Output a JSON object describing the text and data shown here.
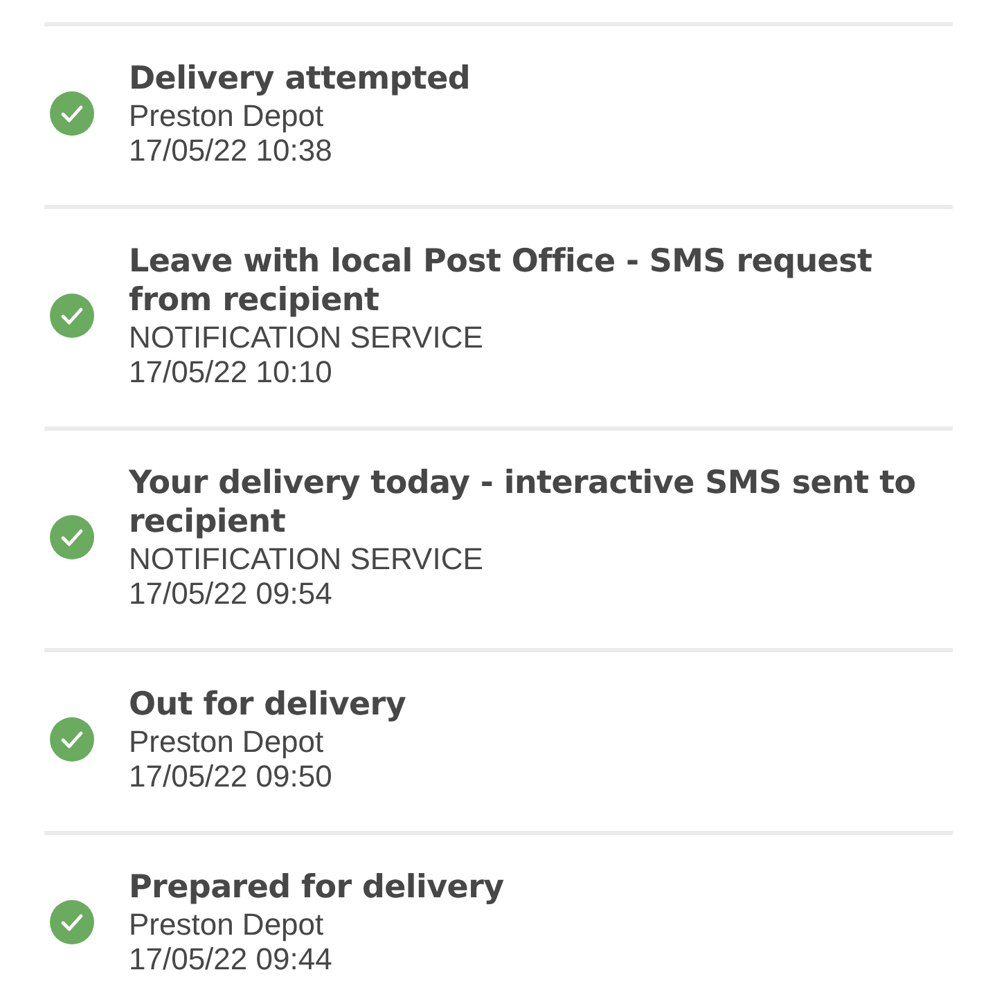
{
  "events": [
    {
      "title": "Delivery attempted",
      "location": "Preston Depot",
      "time": "17/05/22 10:38",
      "completed": true
    },
    {
      "title": "Leave with local Post Office - SMS request from recipient",
      "location": "NOTIFICATION SERVICE",
      "time": "17/05/22 10:10",
      "completed": true
    },
    {
      "title": "Your delivery today - interactive SMS sent to recipient",
      "location": "NOTIFICATION SERVICE",
      "time": "17/05/22 09:54",
      "completed": true
    },
    {
      "title": "Out for delivery",
      "location": "Preston Depot",
      "time": "17/05/22 09:50",
      "completed": true
    },
    {
      "title": "Prepared for delivery",
      "location": "Preston Depot",
      "time": "17/05/22 09:44",
      "completed": true
    }
  ]
}
